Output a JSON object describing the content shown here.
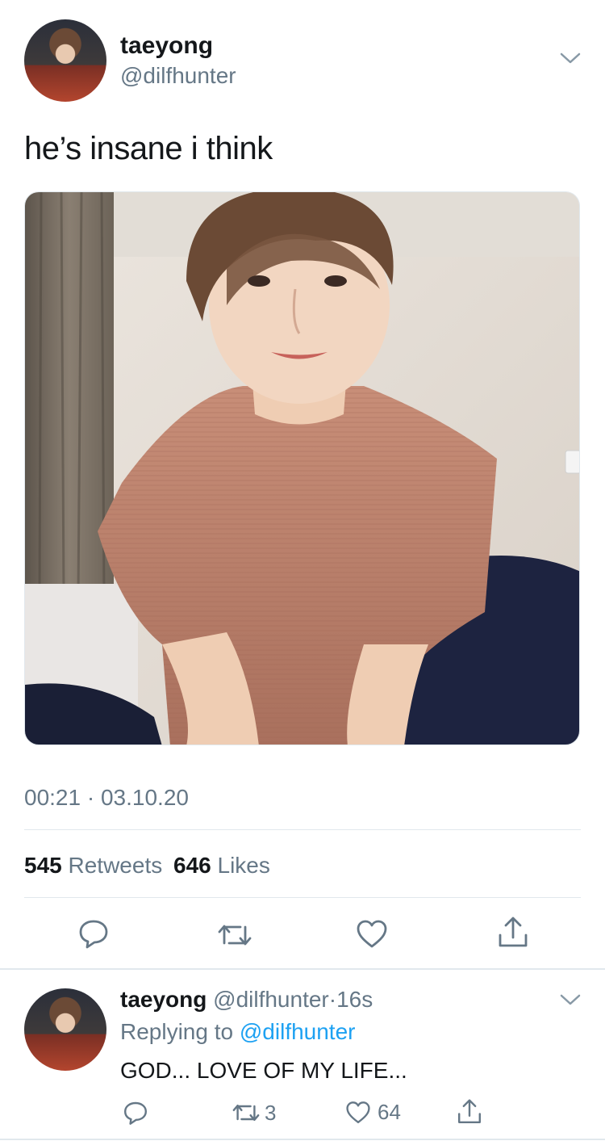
{
  "tweet": {
    "display_name": "taeyong",
    "handle": "@dilfhunter",
    "text": "he’s insane i think",
    "time": "00:21",
    "separator": "·",
    "date": "03.10.20",
    "stats": {
      "retweets_count": "545",
      "retweets_label": "Retweets",
      "likes_count": "646",
      "likes_label": "Likes"
    }
  },
  "reply": {
    "display_name": "taeyong",
    "handle": "@dilfhunter",
    "separator": "·",
    "age": "16s",
    "replying_prefix": "Replying to",
    "replying_to": "@dilfhunter",
    "text": "GOD... LOVE OF MY LIFE...",
    "retweets": "3",
    "likes": "64"
  },
  "icons": [
    "chevron-down-icon",
    "reply-icon",
    "retweet-icon",
    "like-icon",
    "share-icon"
  ],
  "colors": {
    "accent": "#1da1f2",
    "muted": "#657786",
    "divider": "#e1e8ed",
    "text": "#14171a"
  }
}
